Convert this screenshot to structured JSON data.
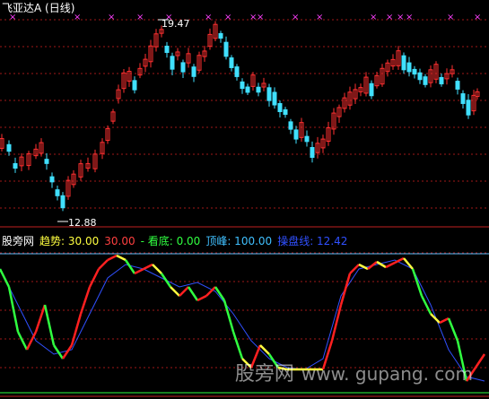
{
  "title": "飞亚达A (日线)",
  "price": {
    "high_label": "19.47",
    "low_label": "12.88"
  },
  "indicator": {
    "name": "股旁网",
    "items": [
      {
        "label": "趋势: 30.00",
        "color": "#ffffff"
      },
      {
        "label": "30.00",
        "color": "#ff4040"
      },
      {
        "label": "- 看底: 0.00",
        "color": "#00ff40"
      },
      {
        "label": "顶峰: 100.00",
        "color": "#40c0ff"
      },
      {
        "label": "操盘线: 12.42",
        "color": "#3050ff"
      }
    ]
  },
  "watermark": {
    "text": "股旁网",
    "domain": "www. gupang. com"
  },
  "colors": {
    "up": "#ff3030",
    "down": "#40e0ff",
    "grid": "#a01818",
    "marker": "#ff40ff"
  }
}
